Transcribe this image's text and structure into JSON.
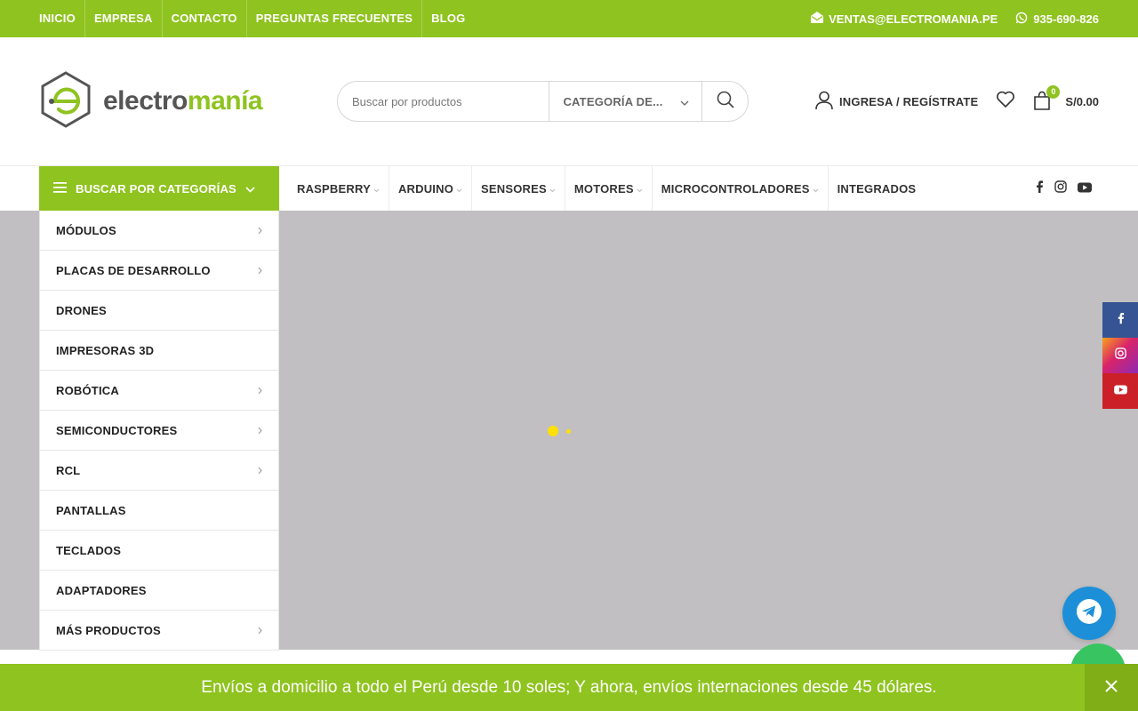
{
  "topbar": {
    "links": [
      "INICIO",
      "EMPRESA",
      "CONTACTO",
      "PREGUNTAS FRECUENTES",
      "BLOG"
    ],
    "email": "VENTAS@ELECTROMANIA.PE",
    "phone": "935-690-826",
    "bg_color": "#8fc31f"
  },
  "logo": {
    "part1": "electro",
    "part2": "manía"
  },
  "search": {
    "placeholder": "Buscar por productos",
    "category_label": "CATEGORÍA DE..."
  },
  "header": {
    "login_label": "INGRESA / REGÍSTRATE",
    "cart_count": "0",
    "cart_total": "S/0.00"
  },
  "nav": {
    "categories_button": "BUSCAR POR CATEGORÍAS",
    "items": [
      "RASPBERRY",
      "ARDUINO",
      "SENSORES",
      "MOTORES",
      "MICROCONTROLADORES",
      "INTEGRADOS"
    ]
  },
  "category_menu": [
    {
      "label": "MÓDULOS",
      "has_submenu": true
    },
    {
      "label": "PLACAS DE DESARROLLO",
      "has_submenu": true
    },
    {
      "label": "DRONES",
      "has_submenu": false
    },
    {
      "label": "IMPRESORAS 3D",
      "has_submenu": false
    },
    {
      "label": "ROBÓTICA",
      "has_submenu": true
    },
    {
      "label": "SEMICONDUCTORES",
      "has_submenu": true
    },
    {
      "label": "RCL",
      "has_submenu": true
    },
    {
      "label": "PANTALLAS",
      "has_submenu": false
    },
    {
      "label": "TECLADOS",
      "has_submenu": false
    },
    {
      "label": "ADAPTADORES",
      "has_submenu": false
    },
    {
      "label": "MÁS PRODUCTOS",
      "has_submenu": true
    }
  ],
  "social": [
    "facebook-icon",
    "instagram-icon",
    "youtube-icon"
  ],
  "banner": {
    "text": "Envíos a domicilio a todo el Perú desde 10 soles; Y ahora, envíos internaciones desde 45 dólares."
  },
  "colors": {
    "accent": "#8fc31f",
    "hero_bg": "#c1bfc1",
    "telegram": "#1d8fd8",
    "whatsapp": "#39c462"
  }
}
